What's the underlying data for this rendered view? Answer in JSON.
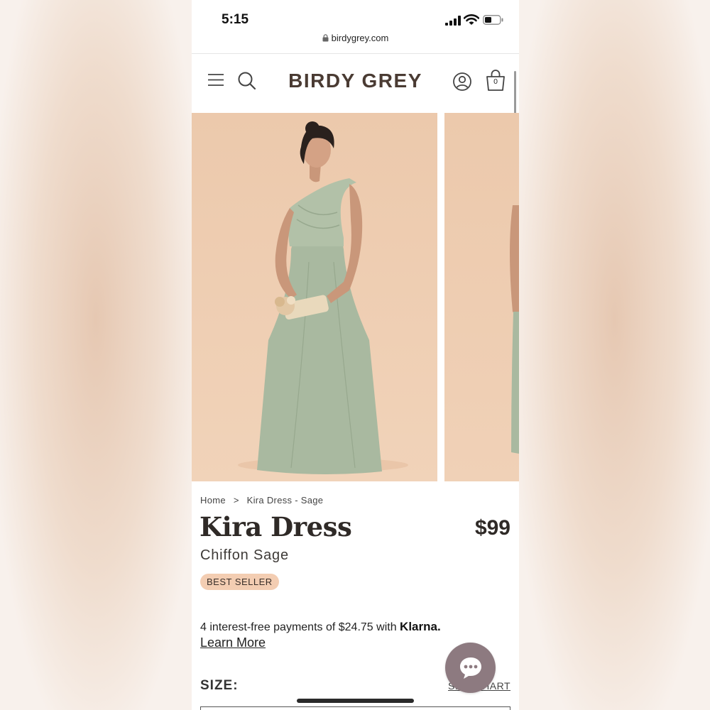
{
  "status_bar": {
    "time": "5:15"
  },
  "browser": {
    "url": "birdygrey.com"
  },
  "header": {
    "brand": "BIRDY GREY",
    "cart_count": "0"
  },
  "breadcrumb": {
    "home": "Home",
    "separator": ">",
    "current": "Kira Dress - Sage"
  },
  "product": {
    "title": "Kira Dress",
    "price": "$99",
    "subtitle": "Chiffon Sage",
    "badge": "BEST SELLER"
  },
  "klarna": {
    "text": "4 interest-free payments of $24.75 with ",
    "brand": "Klarna.",
    "learn_more": "Learn More"
  },
  "size": {
    "label": "SIZE:",
    "chart_link": "SIZE CHART"
  },
  "colors": {
    "brand_text": "#4a3b33",
    "backdrop": "#efcfb4",
    "dress": "#a9b9a0",
    "badge_bg": "#f3cdb2",
    "chat_button": "#8d7a80"
  }
}
